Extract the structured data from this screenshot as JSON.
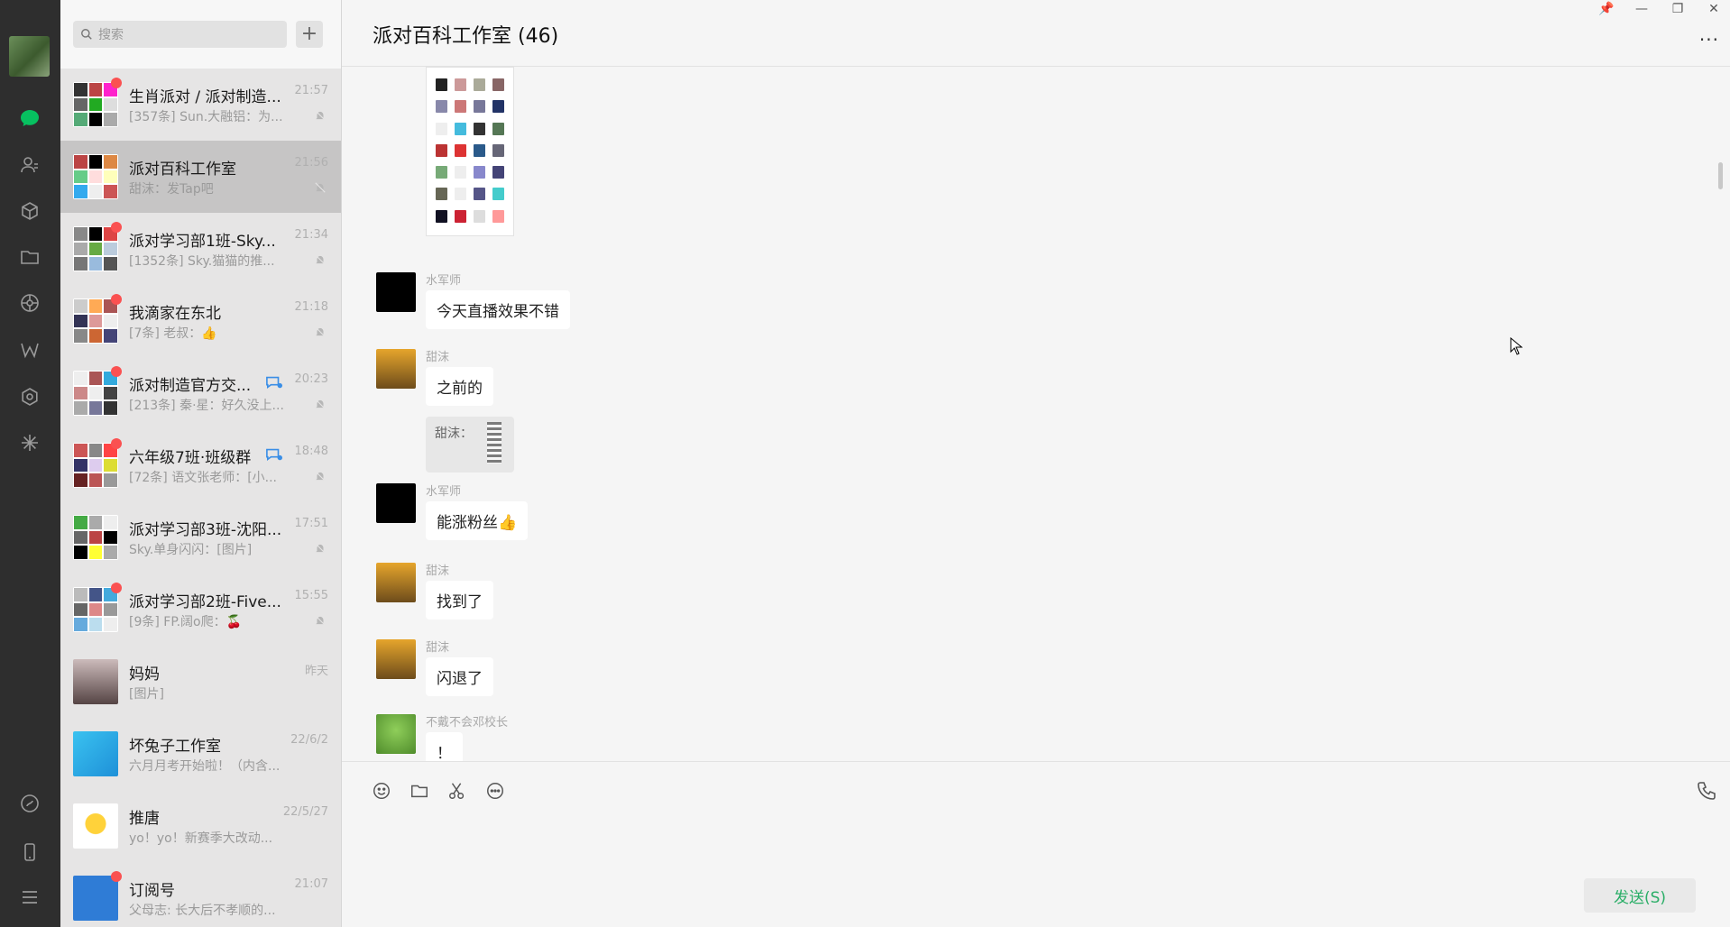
{
  "search": {
    "placeholder": "搜索"
  },
  "chats": [
    {
      "name": "生肖派对 / 派对制造...",
      "time": "21:57",
      "last": "[357条] Sun.大融铝：为...",
      "unread": true,
      "muted": true,
      "group_icon": false,
      "active": false
    },
    {
      "name": "派对百科工作室",
      "time": "21:56",
      "last": "甜沫：发Tap吧",
      "unread": false,
      "muted": true,
      "group_icon": false,
      "active": true
    },
    {
      "name": "派对学习部1班-Sky...",
      "time": "21:34",
      "last": "[1352条] Sky.猫猫的推...",
      "unread": true,
      "muted": true,
      "group_icon": false,
      "active": false
    },
    {
      "name": "我滴家在东北",
      "time": "21:18",
      "last": "[7条] 老叔：👍",
      "unread": true,
      "muted": true,
      "group_icon": false,
      "active": false
    },
    {
      "name": "派对制造官方交...",
      "time": "20:23",
      "last": "[213条] 秦·星：好久没上...",
      "unread": true,
      "muted": true,
      "group_icon": true,
      "active": false
    },
    {
      "name": "六年级7班·班级群",
      "time": "18:48",
      "last": "[72条] 语文张老师：[小...",
      "unread": true,
      "muted": true,
      "group_icon": true,
      "active": false
    },
    {
      "name": "派对学习部3班-沈阳...",
      "time": "17:51",
      "last": "Sky.单身闪闪：[图片]",
      "unread": false,
      "muted": true,
      "group_icon": false,
      "active": false
    },
    {
      "name": "派对学习部2班-Five...",
      "time": "15:55",
      "last": "[9条] FP.阔o爬：🍒",
      "unread": true,
      "muted": true,
      "group_icon": false,
      "active": false
    },
    {
      "name": "妈妈",
      "time": "昨天",
      "last": "[图片]",
      "unread": false,
      "muted": false,
      "group_icon": false,
      "active": false
    },
    {
      "name": "坏兔子工作室",
      "time": "22/6/2",
      "last": "六月月考开始啦！（内含...",
      "unread": false,
      "muted": false,
      "group_icon": false,
      "active": false
    },
    {
      "name": "推唐",
      "time": "22/5/27",
      "last": "yo！yo！新赛季大改动...",
      "unread": false,
      "muted": false,
      "group_icon": false,
      "active": false
    },
    {
      "name": "订阅号",
      "time": "21:07",
      "last": "父母志: 长大后不孝顺的...",
      "unread": true,
      "muted": false,
      "group_icon": false,
      "active": false
    }
  ],
  "chat": {
    "title": "派对百科工作室 (46)"
  },
  "messages": [
    {
      "sender": "水军师",
      "text": "今天直播效果不错"
    },
    {
      "sender": "甜沫",
      "text": "之前的"
    },
    {
      "quote_label": "甜沫："
    },
    {
      "sender": "水军师",
      "text": "能涨粉丝👍"
    },
    {
      "sender": "甜沫",
      "text": "找到了"
    },
    {
      "sender": "甜沫",
      "text": "闪退了"
    },
    {
      "sender": "不戴不会邓校长",
      "text": "！"
    }
  ],
  "send_label": "发送(S)",
  "more_label": "···"
}
